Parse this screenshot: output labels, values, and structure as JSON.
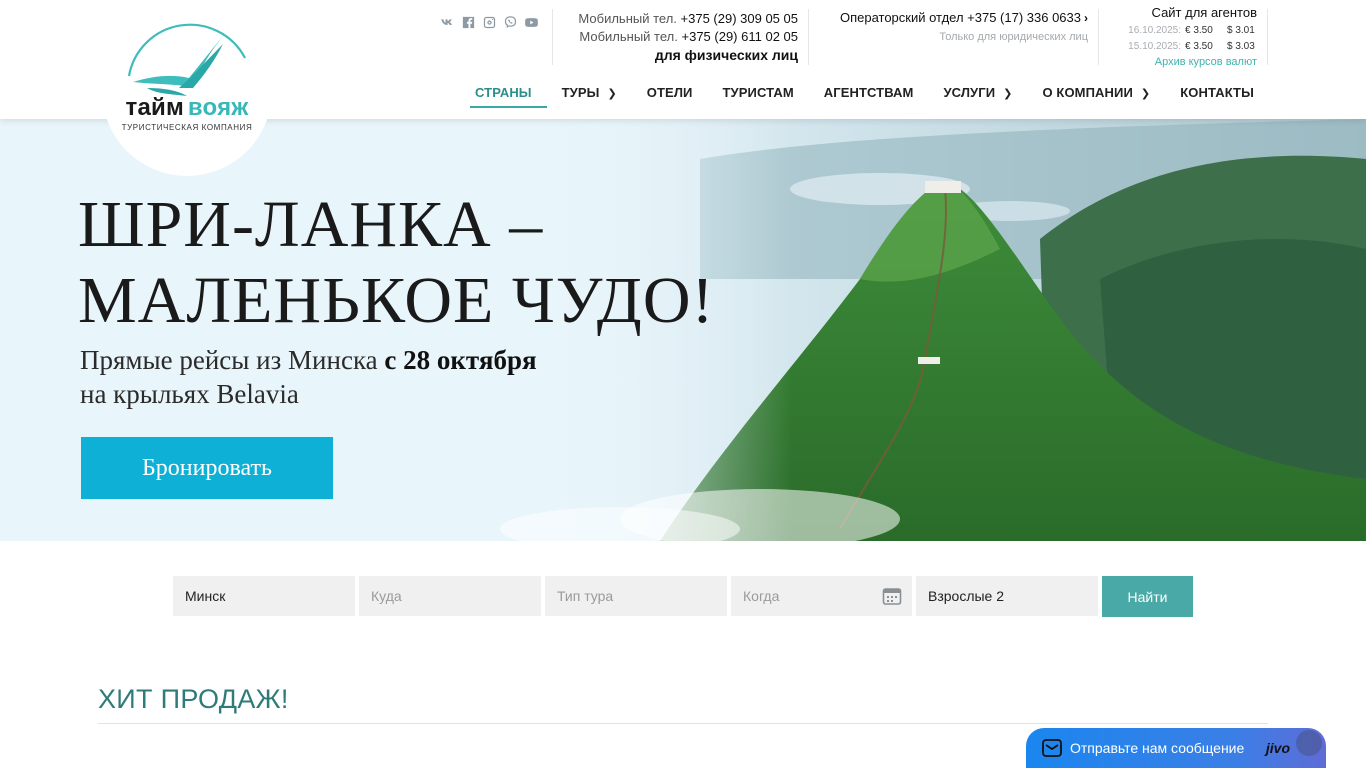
{
  "logo": {
    "brand_part1": "тайм",
    "brand_part2": "вояж",
    "subtitle": "туристическая компания"
  },
  "social": [
    "vk-icon",
    "facebook-icon",
    "instagram-icon",
    "viber-icon",
    "youtube-icon"
  ],
  "phones": {
    "mobile1_label": "Мобильный тел.",
    "mobile1": "+375 (29) 309 05 05",
    "mobile2_label": "Мобильный тел.",
    "mobile2": "+375 (29) 611 02 05",
    "note": "для физических лиц"
  },
  "operator": {
    "text": "Операторский отдел +375 (17) 336 0633",
    "note": "Только для юридических лиц"
  },
  "agents": {
    "title": "Сайт для агентов",
    "rates": [
      {
        "date": "16.10.2025:",
        "eur": "€ 3.50",
        "usd": "$ 3.01"
      },
      {
        "date": "15.10.2025:",
        "eur": "€ 3.50",
        "usd": "$ 3.03"
      }
    ],
    "archive": "Архив курсов валют"
  },
  "nav": [
    {
      "label": "СТРАНЫ",
      "active": true,
      "caret": false
    },
    {
      "label": "ТУРЫ",
      "active": false,
      "caret": true
    },
    {
      "label": "ОТЕЛИ",
      "active": false,
      "caret": false
    },
    {
      "label": "ТУРИСТАМ",
      "active": false,
      "caret": false
    },
    {
      "label": "АГЕНТСТВАМ",
      "active": false,
      "caret": false
    },
    {
      "label": "УСЛУГИ",
      "active": false,
      "caret": true
    },
    {
      "label": "О КОМПАНИИ",
      "active": false,
      "caret": true
    },
    {
      "label": "КОНТАКТЫ",
      "active": false,
      "caret": false
    }
  ],
  "hero": {
    "title_line1": "ШРИ-ЛАНКА –",
    "title_line2": "МАЛЕНЬКОЕ ЧУДО!",
    "sub_line1_pre": "Прямые рейсы из Минска ",
    "sub_line1_bold": "с 28 октября",
    "sub_line2": "на крыльях Belavia",
    "button": "Бронировать"
  },
  "search": {
    "from_value": "Минск",
    "to_placeholder": "Куда",
    "type_placeholder": "Тип тура",
    "when_placeholder": "Когда",
    "adults_value": "Взрослые 2",
    "submit": "Найти"
  },
  "section": {
    "title": "ХИТ ПРОДАЖ!"
  },
  "chat": {
    "label": "Отправьте нам сообщение",
    "brand": "jivo"
  },
  "colors": {
    "accent": "#3aa9a4",
    "hero_button": "#0fb0d6",
    "search_button": "#49a9a6",
    "section_title": "#2e7b79",
    "chat": "#1a86ee"
  }
}
